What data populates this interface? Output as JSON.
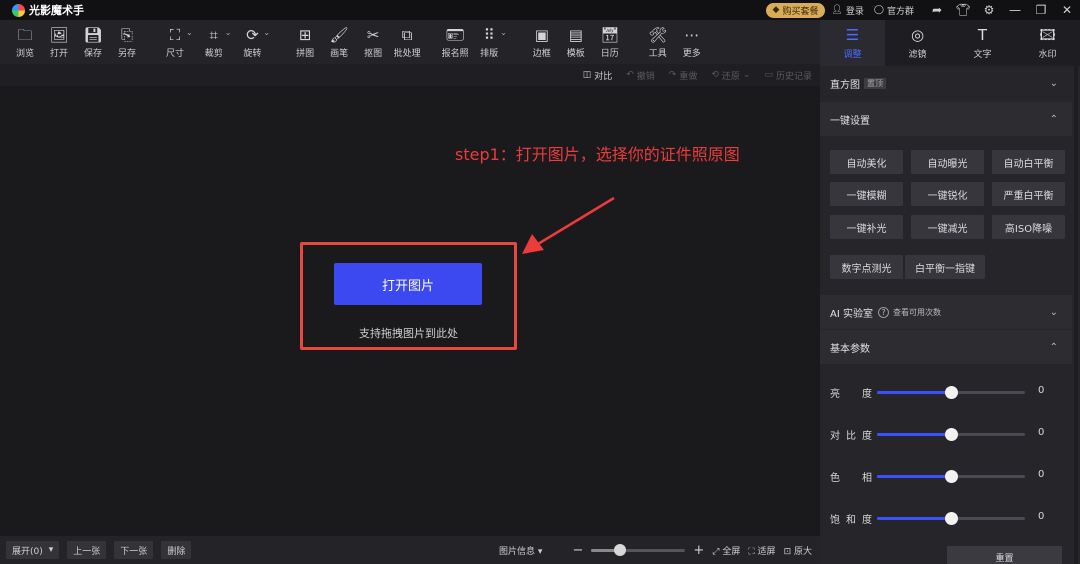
{
  "app": {
    "title": "光影魔术手"
  },
  "titlebar": {
    "vip": "购买套餐",
    "login": "登录",
    "group": "官方群"
  },
  "toolbar": {
    "items": [
      {
        "icon": "folder-icon",
        "label": "浏览"
      },
      {
        "icon": "image-open-icon",
        "label": "打开"
      },
      {
        "icon": "save-icon",
        "label": "保存"
      },
      {
        "icon": "save-as-icon",
        "label": "另存"
      },
      {
        "icon": "resize-icon",
        "label": "尺寸"
      },
      {
        "icon": "crop-icon",
        "label": "裁剪"
      },
      {
        "icon": "rotate-icon",
        "label": "旋转"
      },
      {
        "icon": "collage-icon",
        "label": "拼图"
      },
      {
        "icon": "brush-icon",
        "label": "画笔"
      },
      {
        "icon": "cutout-icon",
        "label": "抠图"
      },
      {
        "icon": "batch-icon",
        "label": "批处理"
      },
      {
        "icon": "id-photo-icon",
        "label": "报名照"
      },
      {
        "icon": "layout-icon",
        "label": "排版"
      },
      {
        "icon": "border-icon",
        "label": "边框"
      },
      {
        "icon": "template-icon",
        "label": "模板"
      },
      {
        "icon": "calendar-icon",
        "label": "日历"
      },
      {
        "icon": "tools-icon",
        "label": "工具"
      },
      {
        "icon": "more-icon",
        "label": "更多"
      }
    ]
  },
  "subtoolbar": {
    "compare": "对比",
    "undo": "撤销",
    "redo": "重做",
    "restore": "还原",
    "history": "历史记录"
  },
  "canvas": {
    "open_button": "打开图片",
    "drag_hint": "支持拖拽图片到此处",
    "annotation": "step1：打开图片，选择你的证件照原图"
  },
  "bottombar": {
    "expand": "展开(0)",
    "prev": "上一张",
    "next": "下一张",
    "delete": "删除",
    "image_info": "图片信息",
    "fullscreen": "全屏",
    "fit": "适屏",
    "original": "原大",
    "zoom": 0.3
  },
  "right_tabs": [
    {
      "icon": "adjust-icon",
      "label": "调整",
      "active": true
    },
    {
      "icon": "filter-icon",
      "label": "滤镜",
      "active": false
    },
    {
      "icon": "text-icon",
      "label": "文字",
      "active": false
    },
    {
      "icon": "watermark-icon",
      "label": "水印",
      "active": false
    }
  ],
  "panel": {
    "histogram": {
      "title": "直方图",
      "tag": "置顶"
    },
    "one_click": {
      "title": "一键设置",
      "presets": [
        "自动美化",
        "自动曝光",
        "自动白平衡",
        "一键模糊",
        "一键锐化",
        "严重白平衡",
        "一键补光",
        "一键减光",
        "高ISO降噪",
        "数字点测光",
        "白平衡一指键"
      ]
    },
    "ai_lab": {
      "title": "AI 实验室",
      "subtitle": "查看可用次数"
    },
    "basic": {
      "title": "基本参数",
      "sliders": [
        {
          "label": "亮度",
          "value": "0",
          "level": 0.5
        },
        {
          "label": "对比度",
          "value": "0",
          "level": 0.5
        },
        {
          "label": "色相",
          "value": "0",
          "level": 0.5
        },
        {
          "label": "饱和度",
          "value": "0",
          "level": 0.5
        }
      ],
      "reset": "重置"
    }
  },
  "colors": {
    "accent": "#3c48f0",
    "annotation": "#ec3b3b",
    "slider": "#3d50ff"
  }
}
